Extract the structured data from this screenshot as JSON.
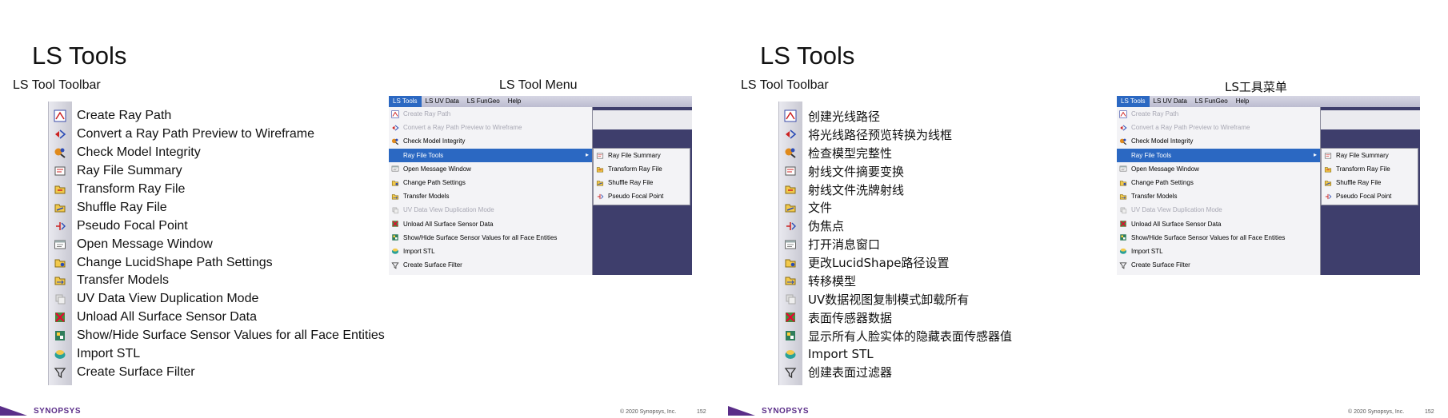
{
  "slide1": {
    "title": "LS Tools",
    "toolbar_label": "LS Tool Toolbar",
    "menu_label": "LS Tool Menu",
    "items": [
      {
        "icon": "create-ray-path-icon",
        "label": "Create Ray Path"
      },
      {
        "icon": "convert-wireframe-icon",
        "label": "Convert a Ray Path Preview to Wireframe"
      },
      {
        "icon": "check-integrity-icon",
        "label": "Check Model Integrity"
      },
      {
        "icon": "ray-file-summary-icon",
        "label": "Ray File Summary"
      },
      {
        "icon": "transform-ray-file-icon",
        "label": "Transform Ray File"
      },
      {
        "icon": "shuffle-ray-file-icon",
        "label": "Shuffle Ray File"
      },
      {
        "icon": "pseudo-focal-point-icon",
        "label": "Pseudo Focal Point"
      },
      {
        "icon": "message-window-icon",
        "label": "Open Message Window"
      },
      {
        "icon": "path-settings-icon",
        "label": "Change LucidShape Path Settings"
      },
      {
        "icon": "transfer-models-icon",
        "label": "Transfer Models"
      },
      {
        "icon": "uv-duplication-icon",
        "label": "UV Data View Duplication Mode"
      },
      {
        "icon": "unload-sensor-icon",
        "label": "Unload All Surface Sensor Data"
      },
      {
        "icon": "show-hide-sensor-icon",
        "label": "Show/Hide Surface Sensor Values for all Face Entities"
      },
      {
        "icon": "import-stl-icon",
        "label": "Import STL"
      },
      {
        "icon": "surface-filter-icon",
        "label": "Create Surface Filter"
      }
    ],
    "copyright": "© 2020 Synopsys, Inc.",
    "page": "152"
  },
  "slide2": {
    "title": "LS Tools",
    "toolbar_label": "LS Tool Toolbar",
    "menu_label": "LS工具菜单",
    "items": [
      {
        "icon": "create-ray-path-icon",
        "label": "创建光线路径"
      },
      {
        "icon": "convert-wireframe-icon",
        "label": "将光线路径预览转换为线框"
      },
      {
        "icon": "check-integrity-icon",
        "label": "检查模型完整性"
      },
      {
        "icon": "ray-file-summary-icon",
        "label": "射线文件摘要变换"
      },
      {
        "icon": "transform-ray-file-icon",
        "label": "射线文件洗牌射线"
      },
      {
        "icon": "shuffle-ray-file-icon",
        "label": "文件"
      },
      {
        "icon": "pseudo-focal-point-icon",
        "label": "伪焦点"
      },
      {
        "icon": "message-window-icon",
        "label": "打开消息窗口"
      },
      {
        "icon": "path-settings-icon",
        "label": "更改LucidShape路径设置"
      },
      {
        "icon": "transfer-models-icon",
        "label": "转移模型"
      },
      {
        "icon": "uv-duplication-icon",
        "label": "UV数据视图复制模式卸载所有"
      },
      {
        "icon": "unload-sensor-icon",
        "label": "表面传感器数据"
      },
      {
        "icon": "show-hide-sensor-icon",
        "label": "显示所有人脸实体的隐藏表面传感器值"
      },
      {
        "icon": "import-stl-icon",
        "label": "Import STL"
      },
      {
        "icon": "surface-filter-icon",
        "label": "创建表面过滤器"
      }
    ],
    "copyright": "© 2020 Synopsys, Inc.",
    "page": "152"
  },
  "menu": {
    "menubar": [
      "LS Tools",
      "LS UV Data",
      "LS FunGeo",
      "Help"
    ],
    "items": [
      {
        "label": "Create Ray Path",
        "state": "disabled"
      },
      {
        "label": "Convert a Ray Path Preview to Wireframe",
        "state": "disabled"
      },
      {
        "label": "Check Model Integrity",
        "state": "normal"
      },
      {
        "label": "Ray File Tools",
        "state": "highlighted"
      },
      {
        "label": "Open Message Window",
        "state": "normal"
      },
      {
        "label": "Change Path Settings",
        "state": "normal"
      },
      {
        "label": "Transfer Models",
        "state": "normal"
      },
      {
        "label": "UV Data View Duplication Mode",
        "state": "disabled"
      },
      {
        "label": "Unload All Surface Sensor Data",
        "state": "normal"
      },
      {
        "label": "Show/Hide Surface Sensor Values for all Face Entities",
        "state": "normal"
      },
      {
        "label": "Import STL",
        "state": "normal"
      },
      {
        "label": "Create Surface Filter",
        "state": "normal"
      }
    ],
    "submenu": [
      "Ray File Summary",
      "Transform Ray File",
      "Shuffle Ray File",
      "Pseudo Focal Point"
    ]
  },
  "brand": "SYNOPSYS",
  "colors": {
    "brand_purple": "#5a2d88",
    "menu_highlight": "#2b68c2",
    "viewport": "#3e3e6c"
  }
}
